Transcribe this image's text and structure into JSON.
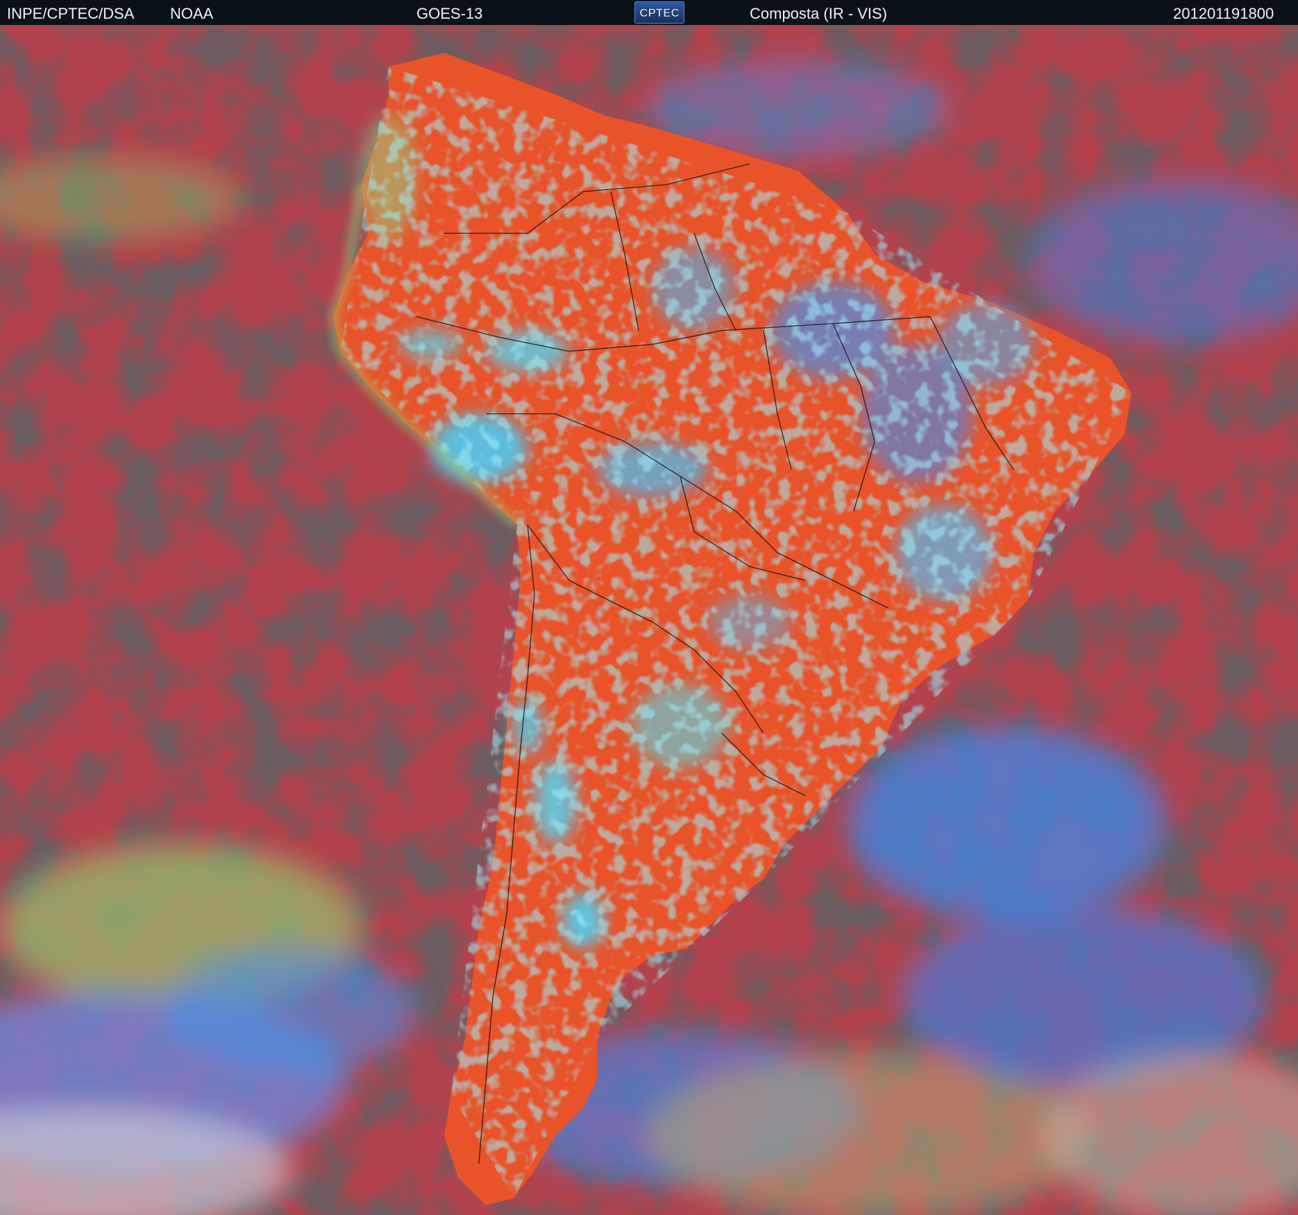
{
  "header": {
    "org": "INPE/CPTEC/DSA",
    "agency": "NOAA",
    "satellite": "GOES-13",
    "logo_text": "CPTEC",
    "product": "Composta (IR - VIS)",
    "timestamp": "201201191800"
  },
  "colors": {
    "header_bg": "#0b1118",
    "ocean_red": "#b2434c",
    "land_orange": "#e8532a",
    "clear_sky_dark": "#1f1f21",
    "cloud_cyan": "#4ec9ef",
    "cloud_blue": "#3f7fe0",
    "cloud_green": "#8fc86a",
    "border_lines": "#111111"
  },
  "image": {
    "subject": "satellite composite of South America",
    "icons": [
      "cptec-logo"
    ]
  }
}
